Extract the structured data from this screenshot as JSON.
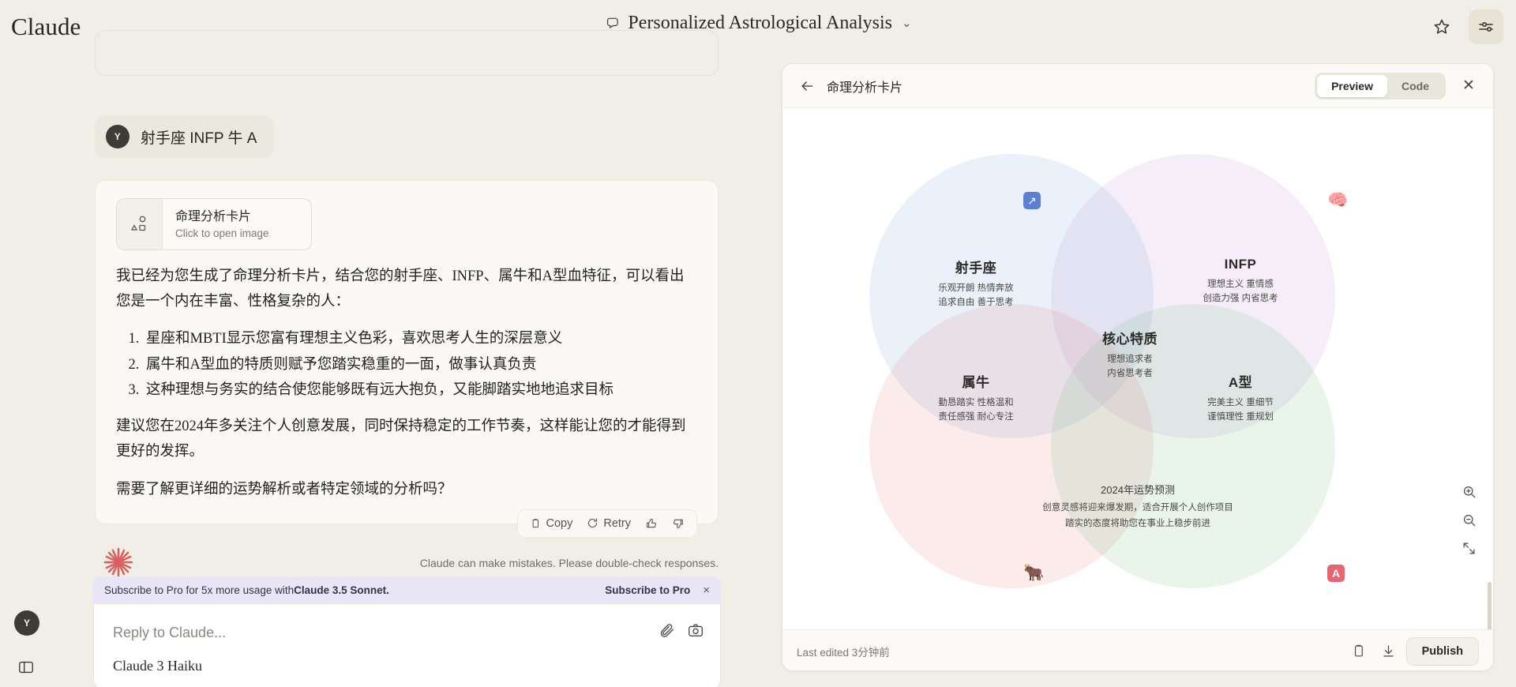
{
  "app": {
    "brand": "Claude"
  },
  "header": {
    "title": "Personalized Astrological Analysis",
    "chevron": "⌄",
    "star_icon": "star-icon",
    "settings_icon": "sliders-icon"
  },
  "chat": {
    "user_message": {
      "avatar": "Y",
      "text": "射手座 INFP 牛 A"
    },
    "artifact_chip": {
      "title": "命理分析卡片",
      "subtitle": "Click to open image",
      "icon": "shapes-icon"
    },
    "assistant": {
      "intro": "我已经为您生成了命理分析卡片，结合您的射手座、INFP、属牛和A型血特征，可以看出您是一个内在丰富、性格复杂的人：",
      "points": [
        "星座和MBTI显示您富有理想主义色彩，喜欢思考人生的深层意义",
        "属牛和A型血的特质则赋予您踏实稳重的一面，做事认真负责",
        "这种理想与务实的结合使您能够既有远大抱负，又能脚踏实地地追求目标"
      ],
      "advice": "建议您在2024年多关注个人创意发展，同时保持稳定的工作节奏，这样能让您的才能得到更好的发挥。",
      "followup": "需要了解更详细的运势解析或者特定领域的分析吗？"
    },
    "actions": {
      "copy": "Copy",
      "retry": "Retry",
      "thumbs_up_icon": "thumbs-up-icon",
      "thumbs_down_icon": "thumbs-down-icon"
    },
    "disclaimer": "Claude can make mistakes. Please double-check responses.",
    "promo": {
      "text_before": "Subscribe to Pro for 5x more usage with ",
      "text_bold": "Claude 3.5 Sonnet.",
      "cta": "Subscribe to Pro",
      "close": "×"
    },
    "composer": {
      "placeholder": "Reply to Claude...",
      "model": "Claude 3 Haiku",
      "attach_icon": "paperclip-icon",
      "camera_icon": "camera-icon"
    },
    "rail": {
      "avatar": "Y",
      "panel_icon": "sidebar-toggle-icon"
    }
  },
  "artifact": {
    "back_icon": "arrow-left-icon",
    "title": "命理分析卡片",
    "tabs": [
      {
        "label": "Preview",
        "active": true
      },
      {
        "label": "Code",
        "active": false
      }
    ],
    "close": "✕",
    "footer": {
      "last_edited": "Last edited 3分钟前",
      "copy_icon": "clipboard-icon",
      "download_icon": "download-icon",
      "publish": "Publish"
    },
    "zoom_controls": {
      "zoom_in_icon": "zoom-in-icon",
      "zoom_out_icon": "zoom-out-icon",
      "fullscreen_icon": "expand-icon"
    },
    "corners": {
      "sagittarius_symbol": "↗",
      "brain_emoji": "🧠",
      "ox_emoji": "🐂",
      "blood_type_a": "A"
    },
    "venn": {
      "groups": [
        {
          "key": "sagittarius",
          "title": "射手座",
          "line1": "乐观开朗 热情奔放",
          "line2": "追求自由 善于思考",
          "color": "#82AAE1"
        },
        {
          "key": "infp",
          "title": "INFP",
          "line1": "理想主义 重情感",
          "line2": "创造力强 内省思考",
          "color": "#BE8CCD"
        },
        {
          "key": "core",
          "title": "核心特质",
          "line1": "理想追求者",
          "line2": "内省思考者",
          "color": "#8A8878"
        },
        {
          "key": "ox",
          "title": "属牛",
          "line1": "勤恳踏实 性格温和",
          "line2": "责任感强 耐心专注",
          "color": "#E67878"
        },
        {
          "key": "blood_a",
          "title": "A型",
          "line1": "完美主义 重细节",
          "line2": "谨慎理性 重规划",
          "color": "#78C382"
        }
      ],
      "forecast": {
        "title": "2024年运势预测",
        "line1": "创意灵感将迎来爆发期，适合开展个人创作项目",
        "line2": "踏实的态度将助您在事业上稳步前进"
      }
    }
  },
  "colors": {
    "page_bg": "#F0EEE7",
    "panel_bg": "#FFFFFF",
    "accent_red": "#E8646E",
    "accent_blue": "#5B7FD1",
    "promo_bg": "#E8E6F5"
  }
}
